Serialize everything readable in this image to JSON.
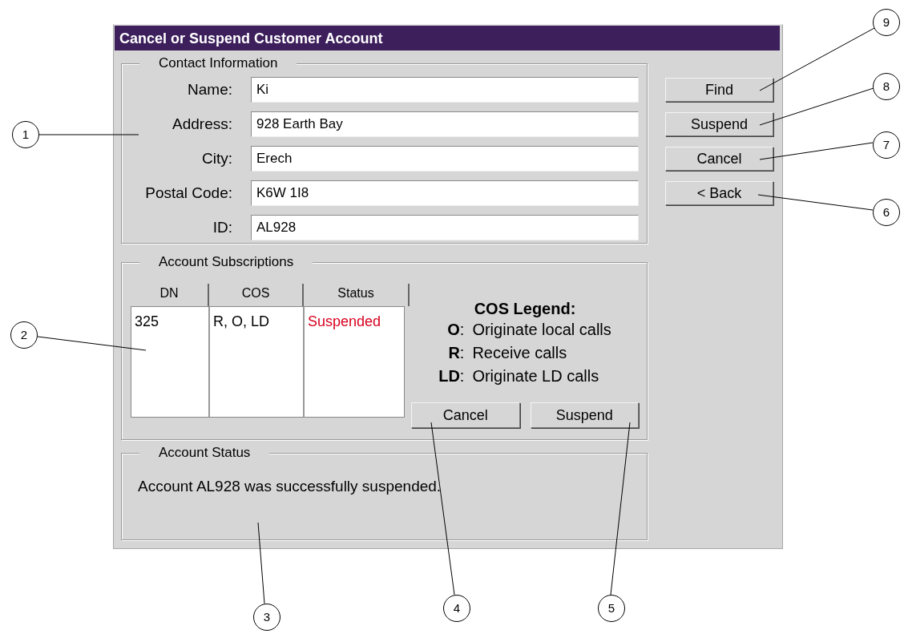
{
  "window": {
    "title": "Cancel or Suspend Customer Account"
  },
  "contact": {
    "title": "Contact Information",
    "fields": [
      {
        "label": "Name:",
        "value": "Ki"
      },
      {
        "label": "Address:",
        "value": "928 Earth Bay"
      },
      {
        "label": "City:",
        "value": "Erech"
      },
      {
        "label": "Postal Code:",
        "value": "K6W 1I8"
      },
      {
        "label": "ID:",
        "value": "AL928"
      }
    ]
  },
  "side_buttons": [
    "Find",
    "Suspend",
    "Cancel",
    "< Back"
  ],
  "subscriptions": {
    "title": "Account Subscriptions",
    "columns": [
      "DN",
      "COS",
      "Status"
    ],
    "rows": [
      {
        "dn": "325",
        "cos": "R, O, LD",
        "status": "Suspended",
        "color": "#d8001e"
      }
    ],
    "legend": {
      "title": "COS Legend:",
      "entries": [
        {
          "code": "**O**:",
          "meaning": "Originate local calls"
        },
        {
          "code": "**R**:",
          "meaning": "Receive calls"
        },
        {
          "code": "**LD**:",
          "meaning": "Originate LD calls"
        }
      ]
    },
    "buttons": [
      "Cancel",
      "Suspend"
    ]
  },
  "account_status": {
    "title": "Account Status",
    "message": "Account AL928 was successfully suspended."
  },
  "callouts": [
    "9",
    "8",
    "1",
    "7",
    "6",
    "2",
    "4",
    "5",
    "3"
  ]
}
